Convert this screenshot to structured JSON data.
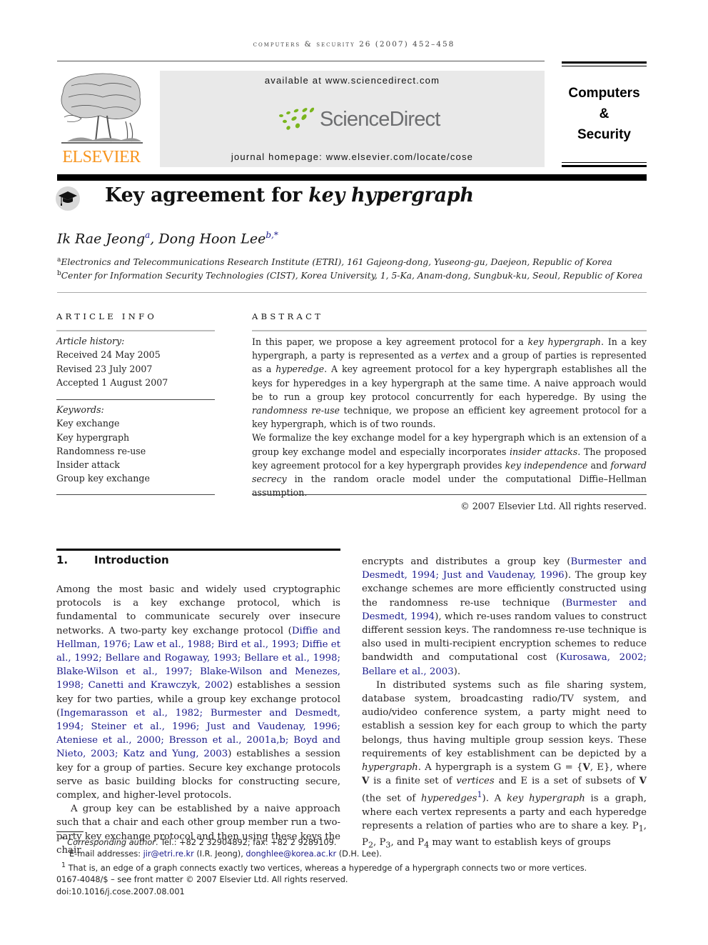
{
  "running_head": "computers & security 26 (2007) 452–458",
  "masthead": {
    "publisher": "ELSEVIER",
    "available_at": "available at www.sciencedirect.com",
    "sciencedirect": "ScienceDirect",
    "journal_homepage": "journal homepage: www.elsevier.com/locate/cose",
    "journal_title_line1": "Computers",
    "journal_title_line2": "&",
    "journal_title_line3": "Security",
    "colors": {
      "elsevier_orange": "#f7941d",
      "sciencedirect_green": "#7ab51d",
      "sciencedirect_grey": "#6d6e70",
      "link_blue": "#1a1a8c"
    }
  },
  "article": {
    "title_plain": "Key agreement for ",
    "title_italic": "key hypergraph",
    "authors": [
      {
        "name": "Ik Rae Jeong",
        "affil": "a"
      },
      {
        "name": "Dong Hoon Lee",
        "affil": "b,*"
      }
    ],
    "author_separator": ", ",
    "affiliations": [
      {
        "mark": "a",
        "text": "Electronics and Telecommunications Research Institute (ETRI), 161 Gajeong-dong, Yuseong-gu, Daejeon, Republic of Korea"
      },
      {
        "mark": "b",
        "text": "Center for Information Security Technologies (CIST), Korea University, 1, 5-Ka, Anam-dong, Sungbuk-ku, Seoul, Republic of Korea"
      }
    ]
  },
  "article_info": {
    "heading": "ARTICLE INFO",
    "history_label": "Article history:",
    "history": [
      "Received 24 May 2005",
      "Revised 23 July 2007",
      "Accepted 1 August 2007"
    ],
    "keywords_label": "Keywords:",
    "keywords": [
      "Key exchange",
      "Key hypergraph",
      "Randomness re-use",
      "Insider attack",
      "Group key exchange"
    ]
  },
  "abstract": {
    "heading": "ABSTRACT",
    "p1": [
      {
        "t": "In this paper, we propose a key agreement protocol for a "
      },
      {
        "t": "key hypergraph",
        "i": true
      },
      {
        "t": ". In a key hypergraph, a party is represented as a "
      },
      {
        "t": "vertex",
        "i": true
      },
      {
        "t": " and a group of parties is represented as a "
      },
      {
        "t": "hyperedge",
        "i": true
      },
      {
        "t": ". A key agreement protocol for a key hypergraph establishes all the keys for hyperedges in a key hypergraph at the same time. A naive approach would be to run a group key protocol concurrently for each hyperedge. By using the "
      },
      {
        "t": "randomness re-use",
        "i": true
      },
      {
        "t": " technique, we propose an efficient key agreement protocol for a key hypergraph, which is of two rounds."
      }
    ],
    "p2": [
      {
        "t": "We formalize the key exchange model for a key hypergraph which is an extension of a group key exchange model and especially incorporates "
      },
      {
        "t": "insider attacks",
        "i": true
      },
      {
        "t": ". The proposed key agreement protocol for a key hypergraph provides "
      },
      {
        "t": "key independence",
        "i": true
      },
      {
        "t": " and "
      },
      {
        "t": "forward secrecy",
        "i": true
      },
      {
        "t": " in the random oracle model under the computational Diffie–Hellman assumption."
      }
    ],
    "copyright": "© 2007 Elsevier Ltd. All rights reserved."
  },
  "section1": {
    "number": "1.",
    "title": "Introduction",
    "left_p1": [
      {
        "t": "Among the most basic and widely used cryptographic protocols is a key exchange protocol, which is fundamental to communicate securely over insecure networks. A two-party key exchange protocol ("
      },
      {
        "t": "Diffie and Hellman, 1976; Law et al., 1988; Bird et al., 1993; Diffie et al., 1992; Bellare and Rogaway, 1993; Bellare et al., 1998; Blake-Wilson et al., 1997; Blake-Wilson and Menezes, 1998; Canetti and Krawczyk, 2002",
        "c": true
      },
      {
        "t": ") establishes a session key for two parties, while a group key exchange protocol ("
      },
      {
        "t": "Ingemarasson et al., 1982; Burmester and Desmedt, 1994; Steiner et al., 1996; Just and Vaudenay, 1996; Ateniese et al., 2000; Bresson et al., 2001a,b; Boyd and Nieto, 2003; Katz and Yung, 2003",
        "c": true
      },
      {
        "t": ") establishes a session key for a group of parties. Secure key exchange protocols serve as basic building blocks for constructing secure, complex, and higher-level protocols."
      }
    ],
    "left_p2": [
      {
        "t": "A group key can be established by a naive approach such that a chair and each other group member run a two-party key exchange protocol and then using these keys the chair"
      }
    ],
    "right_p1": [
      {
        "t": "encrypts and distributes a group key ("
      },
      {
        "t": "Burmester and Desmedt, 1994; Just and Vaudenay, 1996",
        "c": true
      },
      {
        "t": "). The group key exchange schemes are more efficiently constructed using the randomness re-use technique ("
      },
      {
        "t": "Burmester and Desmedt, 1994",
        "c": true
      },
      {
        "t": "), which re-uses random values to construct different session keys. The randomness re-use technique is also used in multi-recipient encryption schemes to reduce bandwidth and computational cost ("
      },
      {
        "t": "Kurosawa, 2002; Bellare et al., 2003",
        "c": true
      },
      {
        "t": ")."
      }
    ],
    "right_p2": [
      {
        "t": "In distributed systems such as file sharing system, database system, broadcasting radio/TV system, and audio/video conference system, a party might need to establish a session key for each group to which the party belongs, thus having multiple group session keys. These requirements of key establishment can be depicted by a "
      },
      {
        "t": "hypergraph",
        "i": true
      },
      {
        "t": ". A hypergraph is a system G = {"
      },
      {
        "t": "V",
        "b": true
      },
      {
        "t": ", E}, where "
      },
      {
        "t": "V",
        "b": true
      },
      {
        "t": " is a finite set of "
      },
      {
        "t": "vertices",
        "i": true
      },
      {
        "t": " and E is a set of subsets of "
      },
      {
        "t": "V",
        "b": true
      },
      {
        "t": " (the set of "
      },
      {
        "t": "hyperedges",
        "i": true
      },
      {
        "t": "1",
        "sup": true
      },
      {
        "t": "). A "
      },
      {
        "t": "key hypergraph",
        "i": true
      },
      {
        "t": " is a graph, where each vertex represents a party and each hyperedge represents a relation of parties who are to share a key. P"
      },
      {
        "t": "1",
        "sub": true
      },
      {
        "t": ", P"
      },
      {
        "t": "2",
        "sub": true
      },
      {
        "t": ", P"
      },
      {
        "t": "3",
        "sub": true
      },
      {
        "t": ", and P"
      },
      {
        "t": "4",
        "sub": true
      },
      {
        "t": " may want to establish keys of groups"
      }
    ]
  },
  "footnotes": {
    "corr_mark": "*",
    "corr_label": "Corresponding author",
    "corr_text": ". Tel.: +82 2 32904892; fax: +82 2 9289109.",
    "email_label": "E-mail addresses: ",
    "email1": "jir@etri.re.kr",
    "email1_owner": " (I.R. Jeong), ",
    "email2": "donghlee@korea.ac.kr",
    "email2_owner": " (D.H. Lee).",
    "fn1_mark": "1",
    "fn1_text": " That is, an edge of a graph connects exactly two vertices, whereas a hyperedge of a hypergraph connects two or more vertices.",
    "front_matter": "0167-4048/$ – see front matter © 2007 Elsevier Ltd. All rights reserved.",
    "doi": "doi:10.1016/j.cose.2007.08.001"
  }
}
